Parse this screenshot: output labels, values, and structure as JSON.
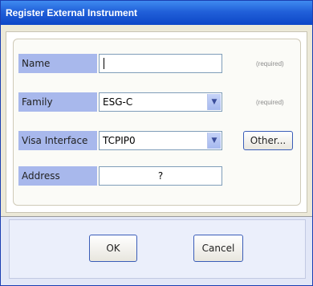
{
  "window": {
    "title": "Register External Instrument"
  },
  "form": {
    "name": {
      "label": "Name",
      "value": "",
      "hint": "(required)"
    },
    "family": {
      "label": "Family",
      "value": "ESG-C",
      "hint": "(required)"
    },
    "visa": {
      "label": "Visa Interface",
      "value": "TCPIP0",
      "other_button": "Other..."
    },
    "address": {
      "label": "Address",
      "value": "?"
    }
  },
  "buttons": {
    "ok": "OK",
    "cancel": "Cancel"
  },
  "colors": {
    "titlebar": "#2160d9",
    "label_bg": "#a8b8ec",
    "footer_bg": "#e2e7f7"
  }
}
